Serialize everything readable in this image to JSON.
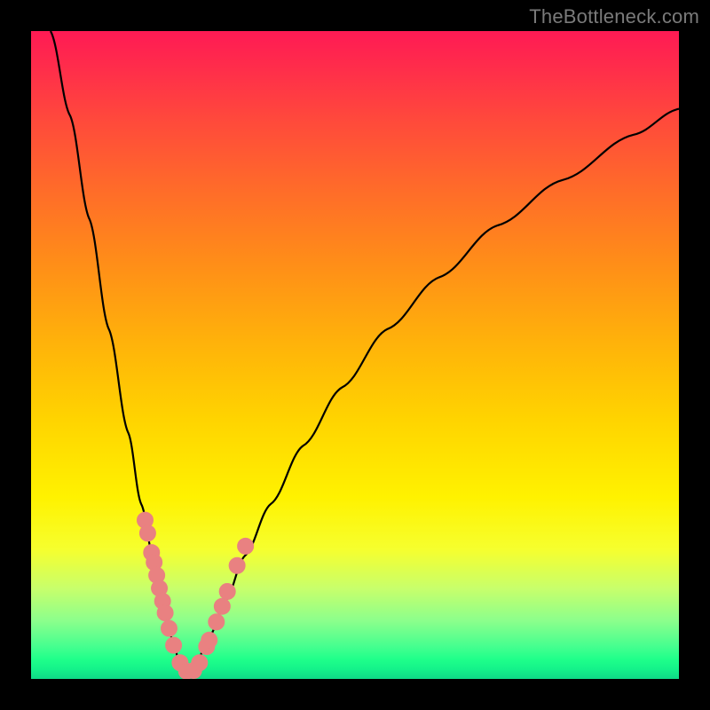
{
  "watermark": "TheBottleneck.com",
  "colors": {
    "dot": "#e98181",
    "curve": "#000000",
    "background": "#000000"
  },
  "chart_data": {
    "type": "line",
    "title": "",
    "subtitle": "",
    "xlabel": "",
    "ylabel": "",
    "xlim": [
      0,
      100
    ],
    "ylim": [
      0,
      100
    ],
    "grid": false,
    "legend": false,
    "notes": "V-shaped bottleneck curve with gradient heat background (red high, green low). Minimum near x≈24. Scatter points cluster along the curve near the minimum on both branches. Axes have no tick labels; values are relative estimates from pixel positions.",
    "series": [
      {
        "name": "curve_left_branch",
        "x": [
          3,
          6,
          9,
          12,
          15,
          17,
          19,
          20.5,
          22,
          23,
          24
        ],
        "y": [
          100,
          87,
          71,
          54,
          38,
          27,
          18,
          11,
          5.5,
          2,
          0.5
        ]
      },
      {
        "name": "curve_right_branch",
        "x": [
          24,
          25.5,
          27.5,
          30,
          33,
          37,
          42,
          48,
          55,
          63,
          72,
          82,
          93,
          100
        ],
        "y": [
          0.5,
          2.5,
          6.5,
          12,
          19,
          27,
          36,
          45,
          54,
          62,
          70,
          77,
          84,
          88
        ]
      },
      {
        "name": "scatter_points",
        "x": [
          17.6,
          18.0,
          18.6,
          19.0,
          19.4,
          19.8,
          20.3,
          20.7,
          21.3,
          22.0,
          23.0,
          24.0,
          25.1,
          26.0,
          27.1,
          27.5,
          28.6,
          29.5,
          30.3,
          31.8,
          33.1
        ],
        "y": [
          24.5,
          22.5,
          19.5,
          18.0,
          16.0,
          14.0,
          12.0,
          10.2,
          7.8,
          5.2,
          2.5,
          1.2,
          1.3,
          2.5,
          5.0,
          6.0,
          8.8,
          11.2,
          13.5,
          17.5,
          20.5
        ]
      }
    ]
  }
}
